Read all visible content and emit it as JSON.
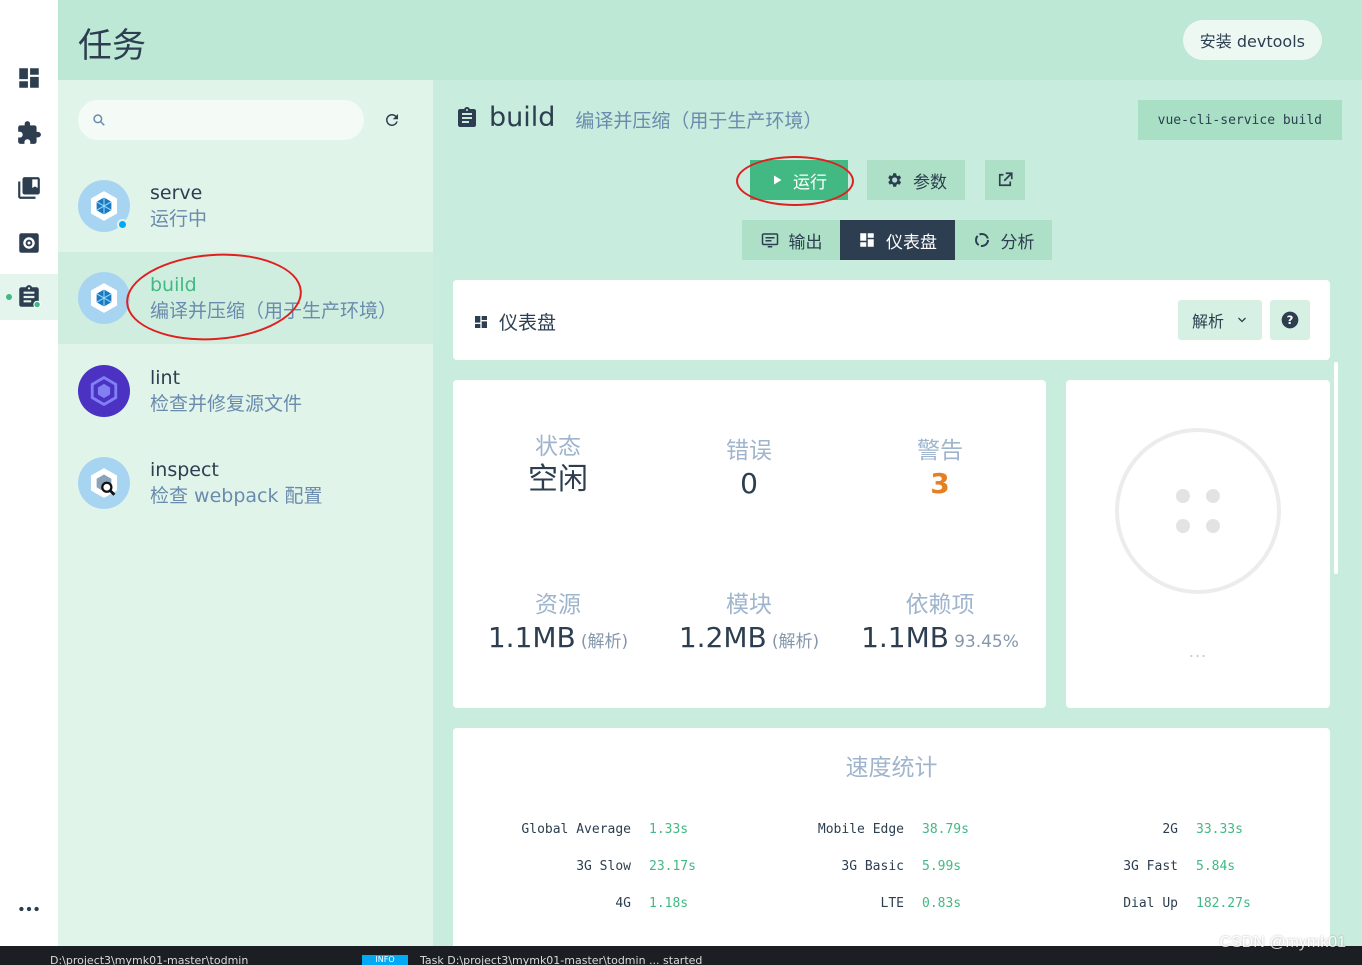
{
  "header": {
    "title": "任务",
    "devtools_label": "安装 devtools"
  },
  "rail": {
    "items": [
      {
        "icon": "dashboard-icon"
      },
      {
        "icon": "plugin-icon"
      },
      {
        "icon": "dependencies-icon"
      },
      {
        "icon": "config-icon"
      },
      {
        "icon": "tasks-icon",
        "active": true
      }
    ]
  },
  "search": {
    "placeholder": "",
    "value": ""
  },
  "tasks": [
    {
      "name": "serve",
      "desc": "运行中",
      "running": true
    },
    {
      "name": "build",
      "desc": "编译并压缩（用于生产环境）",
      "selected": true
    },
    {
      "name": "lint",
      "desc": "检查并修复源文件"
    },
    {
      "name": "inspect",
      "desc": "检查 webpack 配置"
    }
  ],
  "detail": {
    "name": "build",
    "desc": "编译并压缩（用于生产环境）",
    "command": "vue-cli-service build",
    "run_label": "运行",
    "params_label": "参数",
    "tabs": {
      "output": "输出",
      "dashboard": "仪表盘",
      "analyzer": "分析"
    }
  },
  "dashboard": {
    "title": "仪表盘",
    "mode": "解析",
    "stats": {
      "status": {
        "label": "状态",
        "value": "空闲"
      },
      "errors": {
        "label": "错误",
        "value": "0"
      },
      "warnings": {
        "label": "警告",
        "value": "3"
      },
      "assets": {
        "label": "资源",
        "value": "1.1MB",
        "sub": "(解析)"
      },
      "modules": {
        "label": "模块",
        "value": "1.2MB",
        "sub": "(解析)"
      },
      "deps": {
        "label": "依赖项",
        "value": "1.1MB",
        "sub": "93.45%"
      }
    },
    "more": "..."
  },
  "speed": {
    "title": "速度统计",
    "rows": [
      [
        {
          "k": "Global Average",
          "v": "1.33s"
        },
        {
          "k": "Mobile Edge",
          "v": "38.79s"
        },
        {
          "k": "2G",
          "v": "33.33s"
        }
      ],
      [
        {
          "k": "3G Slow",
          "v": "23.17s"
        },
        {
          "k": "3G Basic",
          "v": "5.99s"
        },
        {
          "k": "3G Fast",
          "v": "5.84s"
        }
      ],
      [
        {
          "k": "4G",
          "v": "1.18s"
        },
        {
          "k": "LTE",
          "v": "0.83s"
        },
        {
          "k": "Dial Up",
          "v": "182.27s"
        }
      ]
    ]
  },
  "statusbar": {
    "path": "D:\\project3\\mymk01-master\\todmin",
    "badge": "INFO",
    "message": "Task D:\\project3\\mymk01-master\\todmin ... started",
    "watermark": "CSDN @mymk01"
  },
  "colors": {
    "accent": "#42b983",
    "warning": "#e67e22",
    "dark": "#2c3e50",
    "annotation": "#e02020"
  }
}
